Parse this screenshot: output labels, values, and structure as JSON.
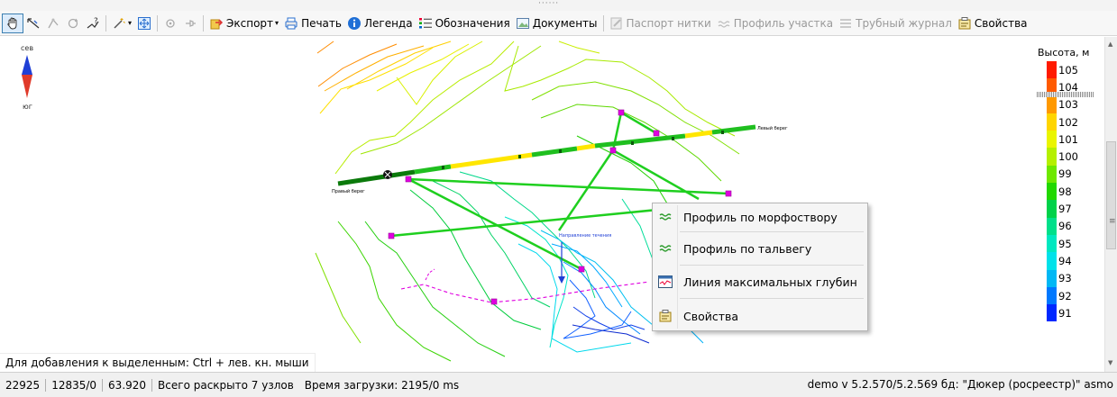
{
  "toolbar": {
    "export_label": "Экспорт",
    "print_label": "Печать",
    "legend_label": "Легенда",
    "notation_label": "Обозначения",
    "documents_label": "Документы",
    "passport_label": "Паспорт нитки",
    "section_profile_label": "Профиль участка",
    "pipe_log_label": "Трубный журнал",
    "properties_label": "Свойства"
  },
  "compass": {
    "north": "сев",
    "south": "юг"
  },
  "legend": {
    "title": "Высота, м",
    "levels": [
      {
        "value": "105",
        "color": "#ff1a00"
      },
      {
        "value": "104",
        "color": "#ff5a00"
      },
      {
        "value": "103",
        "color": "#ff9900"
      },
      {
        "value": "102",
        "color": "#ffd500"
      },
      {
        "value": "101",
        "color": "#eaf500"
      },
      {
        "value": "100",
        "color": "#b5f000"
      },
      {
        "value": "99",
        "color": "#6ee800"
      },
      {
        "value": "98",
        "color": "#22d800"
      },
      {
        "value": "97",
        "color": "#00d24a"
      },
      {
        "value": "96",
        "color": "#00e08a"
      },
      {
        "value": "95",
        "color": "#00e8c0"
      },
      {
        "value": "94",
        "color": "#00e2ea"
      },
      {
        "value": "93",
        "color": "#00b8f5"
      },
      {
        "value": "92",
        "color": "#0078ff"
      },
      {
        "value": "91",
        "color": "#0028ff"
      }
    ]
  },
  "map": {
    "left_bank_label": "Левый берег",
    "right_bank_label": "Правый берег",
    "flow_label": "Направление течения"
  },
  "context_menu": {
    "items": [
      {
        "label": "Профиль по морфоствору",
        "icon": "wave-icon"
      },
      {
        "label": "Профиль по тальвегу",
        "icon": "wave-icon"
      },
      {
        "label": "Линия максимальных глубин",
        "icon": "depth-chart-icon"
      },
      {
        "label": "Свойства",
        "icon": "properties-icon"
      }
    ]
  },
  "hint": "Для добавления к выделенным: Ctrl + лев. кн. мыши",
  "status": {
    "coord1": "22925",
    "coord2": "12835/0",
    "scale": "63.920",
    "nodes": "Всего раскрыто 7 узлов",
    "load_time": "Время загрузки: 2195/0 ms",
    "version_info": "demo  v 5.2.570/5.2.569  бд: \"Дюкер (росреестр)\" asmo"
  },
  "colors": {
    "pipe_green": "#1fbf1f",
    "pipe_yellow": "#ffe600",
    "node_magenta": "#e000e0",
    "flow_arrow": "#1f3fd6"
  }
}
